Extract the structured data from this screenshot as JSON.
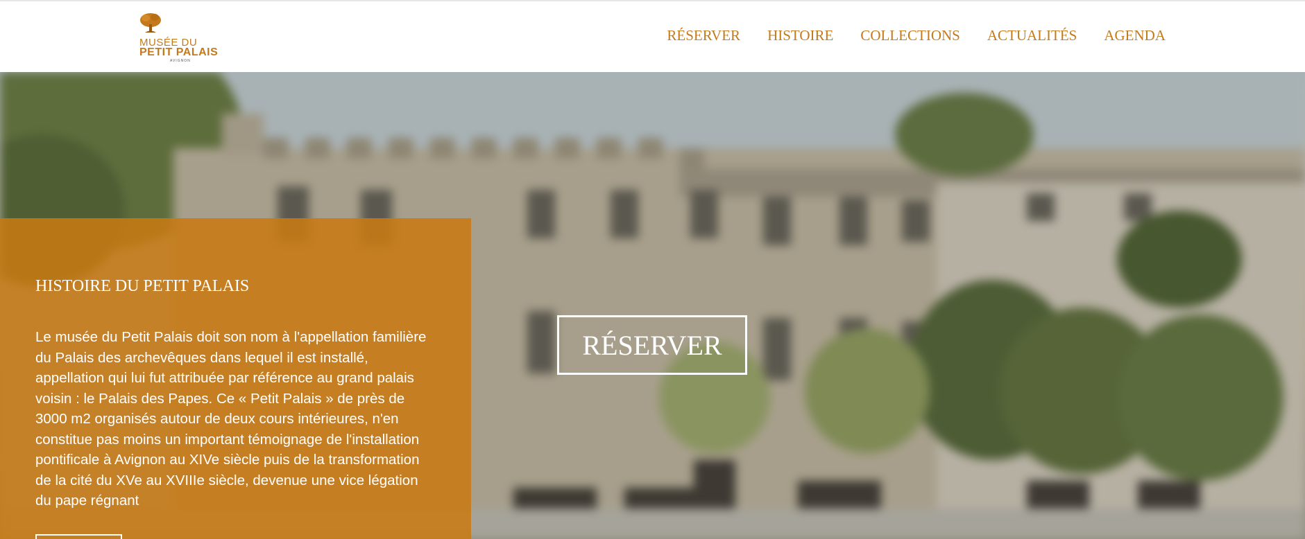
{
  "logo": {
    "line1": "MUSÉE DU",
    "line2": "PETIT PALAIS",
    "line3": "AVIGNON"
  },
  "nav": {
    "items": [
      "RÉSERVER",
      "HISTOIRE",
      "COLLECTIONS",
      "ACTUALITÉS",
      "AGENDA"
    ]
  },
  "hero": {
    "cta_label": "RÉSERVER"
  },
  "panel": {
    "title": "HISTOIRE DU PETIT PALAIS",
    "text": "Le musée du Petit Palais doit son nom à l'appellation familière du Palais des archevêques dans lequel il est installé, appellation qui lui fut attribuée par référence au grand palais voisin : le Palais des Papes. Ce « Petit Palais » de près de 3000 m2  organisés autour de deux cours intérieures, n'en constitue pas moins un important témoignage de l'installation pontificale à Avignon au XIVe siècle puis de la transformation de la cité du XVe au XVIIIe siècle, devenue une vice légation du pape régnant"
  },
  "colors": {
    "accent": "#c47a1c",
    "panel": "#c97a12",
    "text_on_dark": "#ffffff"
  }
}
